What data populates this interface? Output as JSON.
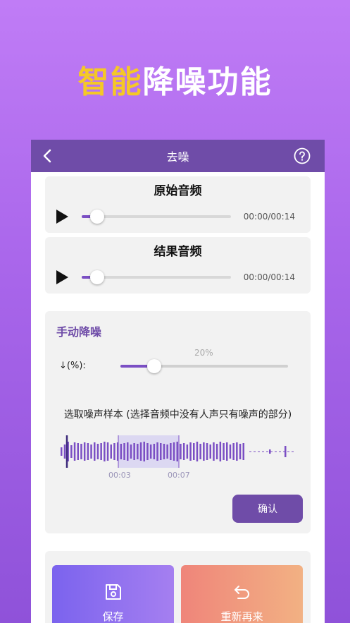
{
  "hero": {
    "highlight": "智能",
    "rest": "降噪功能"
  },
  "topbar": {
    "title": "去噪"
  },
  "original_audio": {
    "title": "原始音频",
    "time": "00:00/00:14",
    "progress": 0.05
  },
  "result_audio": {
    "title": "结果音频",
    "time": "00:00/00:14",
    "progress": 0.05
  },
  "manual": {
    "title": "手动降噪",
    "pct_label": "↓(%):",
    "pct_value": "20%",
    "level": 0.2,
    "sample_text": "选取噪声样本 (选择音频中没有人声只有噪声的部分)",
    "mark_start": "00:03",
    "mark_end": "00:07",
    "confirm": "确认"
  },
  "actions": {
    "save": "保存",
    "redo": "重新再来"
  },
  "colors": {
    "accent": "#6f4ca8",
    "highlight": "#f5c826"
  }
}
